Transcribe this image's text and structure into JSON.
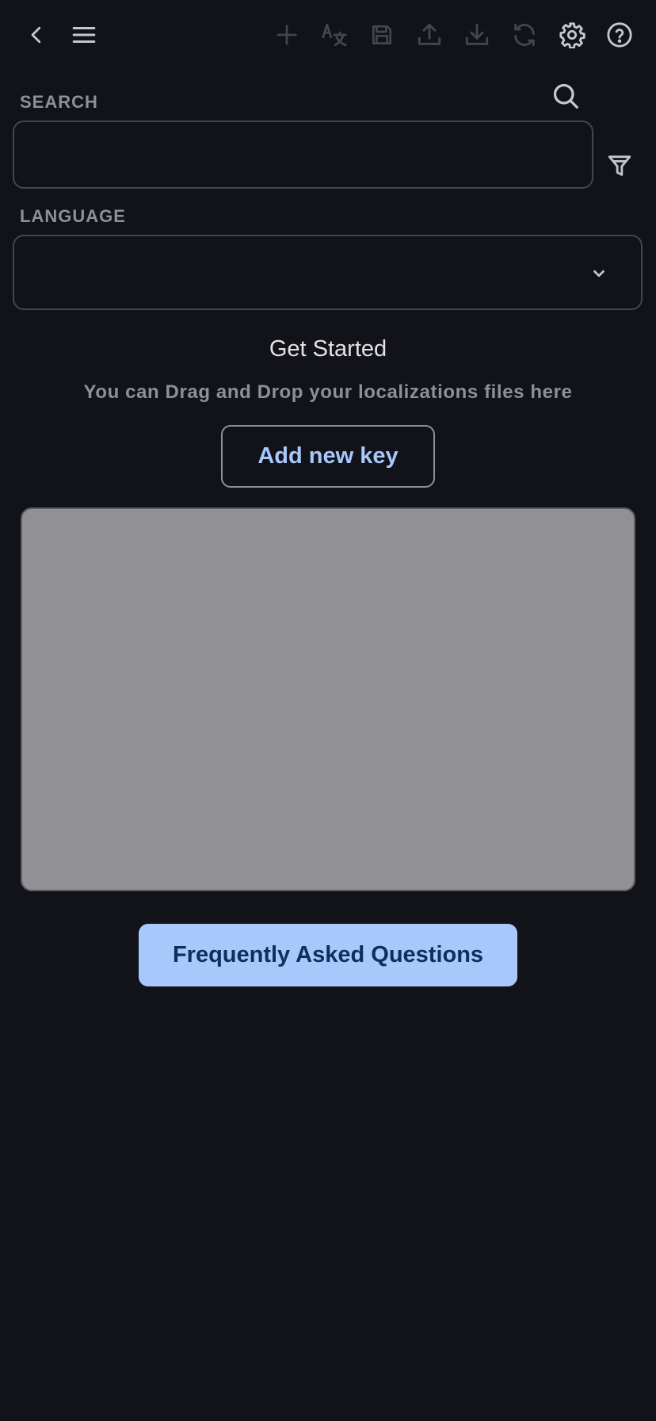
{
  "toolbar": {
    "icons": [
      "back-icon",
      "menu-icon",
      "add-icon",
      "translate-icon",
      "save-icon",
      "upload-icon",
      "download-icon",
      "sync-icon",
      "settings-icon",
      "help-icon",
      "search-icon",
      "filter-icon",
      "chevron-down-icon"
    ]
  },
  "search": {
    "label": "SEARCH",
    "value": "",
    "placeholder": ""
  },
  "language": {
    "label": "LANGUAGE",
    "selected": ""
  },
  "main": {
    "title": "Get Started",
    "subtitle": "You can Drag and Drop your localizations files here",
    "add_key_label": "Add new key"
  },
  "faq": {
    "label": "Frequently Asked Questions"
  },
  "colors": {
    "background": "#111318",
    "accent": "#a8c7fa",
    "outline": "#44464f",
    "muted_text": "#8e9099",
    "dropzone": "#919095"
  }
}
